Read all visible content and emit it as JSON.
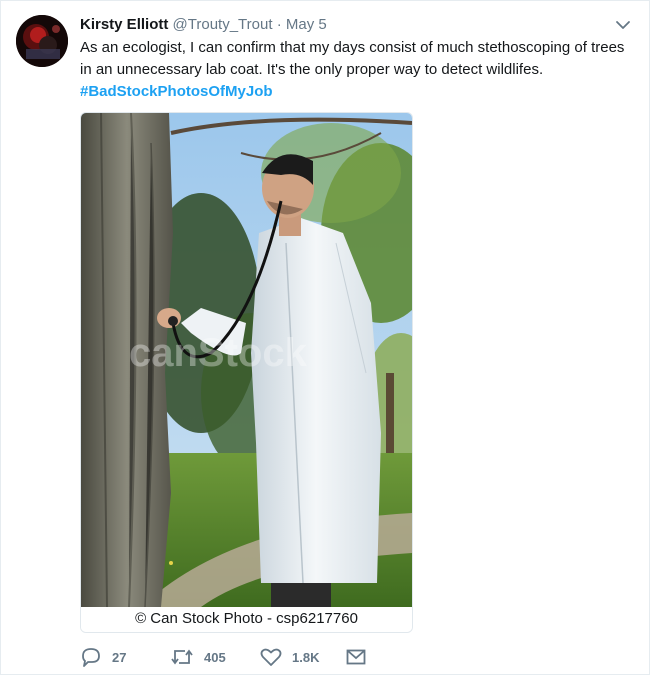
{
  "tweet": {
    "author_name": "Kirsty Elliott",
    "handle": "@Trouty_Trout",
    "separator": "·",
    "date": "May 5",
    "body": "As an ecologist, I can confirm that my days consist of much stethoscoping of trees in an unnecessary lab coat. It's the only proper way to detect wildlifes.",
    "hashtag": "#BadStockPhotosOfMyJob",
    "media": {
      "watermark": "canStock",
      "credit": "© Can Stock Photo - csp6217760"
    },
    "actions": {
      "replies": "27",
      "retweets": "405",
      "likes": "1.8K"
    },
    "icons": {
      "menu": "chevron-down-icon",
      "reply": "reply-icon",
      "retweet": "retweet-icon",
      "like": "heart-icon",
      "message": "envelope-icon"
    },
    "colors": {
      "link": "#1da1f2",
      "meta": "#657786",
      "text": "#14171a"
    }
  }
}
